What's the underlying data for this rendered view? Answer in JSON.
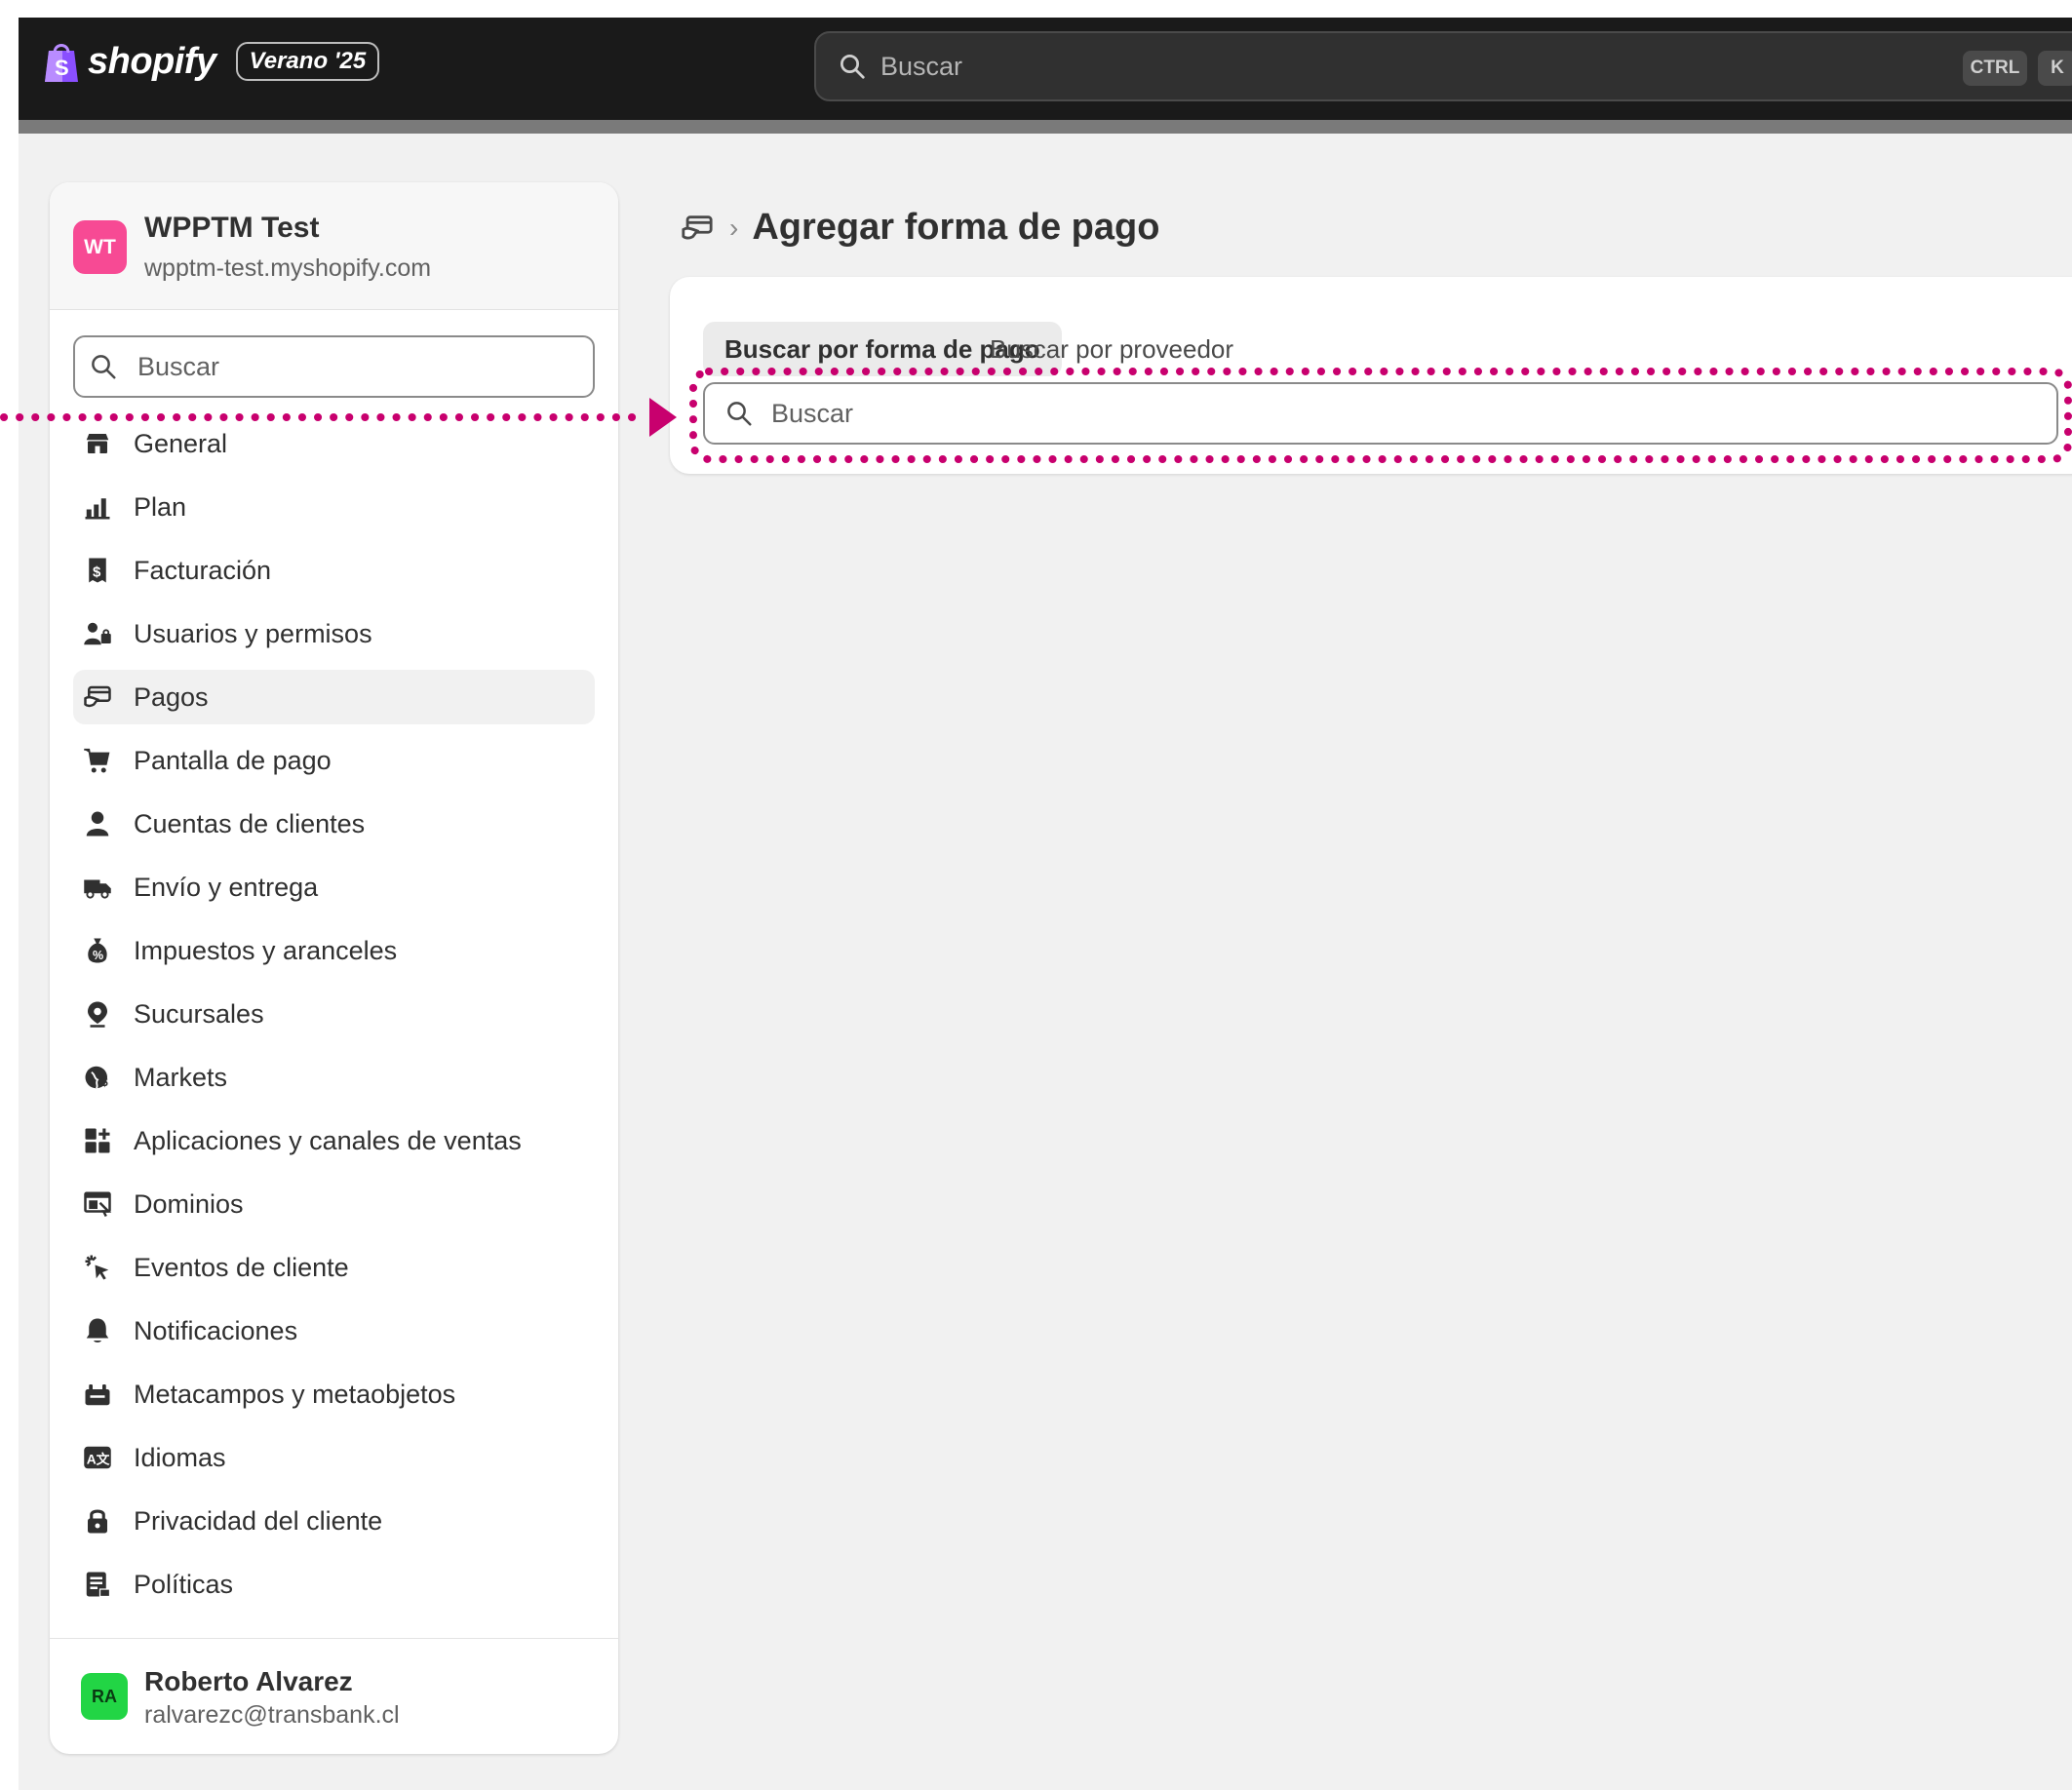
{
  "topbar": {
    "brand": "shopify",
    "edition": "Verano '25",
    "search_placeholder": "Buscar",
    "shortcut_ctrl": "CTRL",
    "shortcut_k": "K"
  },
  "sidebar": {
    "store_initials": "WT",
    "store_name": "WPPTM Test",
    "store_domain": "wpptm-test.myshopify.com",
    "search_placeholder": "Buscar",
    "items": [
      {
        "label": "General",
        "icon": "store-icon"
      },
      {
        "label": "Plan",
        "icon": "plan-icon"
      },
      {
        "label": "Facturación",
        "icon": "receipt-icon"
      },
      {
        "label": "Usuarios y permisos",
        "icon": "users-icon"
      },
      {
        "label": "Pagos",
        "icon": "payments-icon",
        "active": true
      },
      {
        "label": "Pantalla de pago",
        "icon": "cart-icon"
      },
      {
        "label": "Cuentas de clientes",
        "icon": "person-icon"
      },
      {
        "label": "Envío y entrega",
        "icon": "truck-icon"
      },
      {
        "label": "Impuestos y aranceles",
        "icon": "tax-icon"
      },
      {
        "label": "Sucursales",
        "icon": "location-icon"
      },
      {
        "label": "Markets",
        "icon": "globe-icon"
      },
      {
        "label": "Aplicaciones y canales de ventas",
        "icon": "apps-icon"
      },
      {
        "label": "Dominios",
        "icon": "domain-icon"
      },
      {
        "label": "Eventos de cliente",
        "icon": "cursor-click-icon"
      },
      {
        "label": "Notificaciones",
        "icon": "bell-icon"
      },
      {
        "label": "Metacampos y metaobjetos",
        "icon": "metafields-icon"
      },
      {
        "label": "Idiomas",
        "icon": "language-icon"
      },
      {
        "label": "Privacidad del cliente",
        "icon": "lock-icon"
      },
      {
        "label": "Políticas",
        "icon": "policy-icon"
      }
    ],
    "user_initials": "RA",
    "user_name": "Roberto Alvarez",
    "user_email": "ralvarezc@transbank.cl"
  },
  "main": {
    "page_title": "Agregar forma de pago",
    "tabs": [
      {
        "label": "Buscar por forma de pago",
        "selected": true
      },
      {
        "label": "Buscar por proveedor",
        "selected": false
      }
    ],
    "search_placeholder": "Buscar"
  },
  "colors": {
    "topbar_bg": "#1a1a1a",
    "page_bg": "#f1f1f1",
    "store_avatar": "#f74a94",
    "user_avatar": "#22d545",
    "annotation": "#c8006e"
  }
}
